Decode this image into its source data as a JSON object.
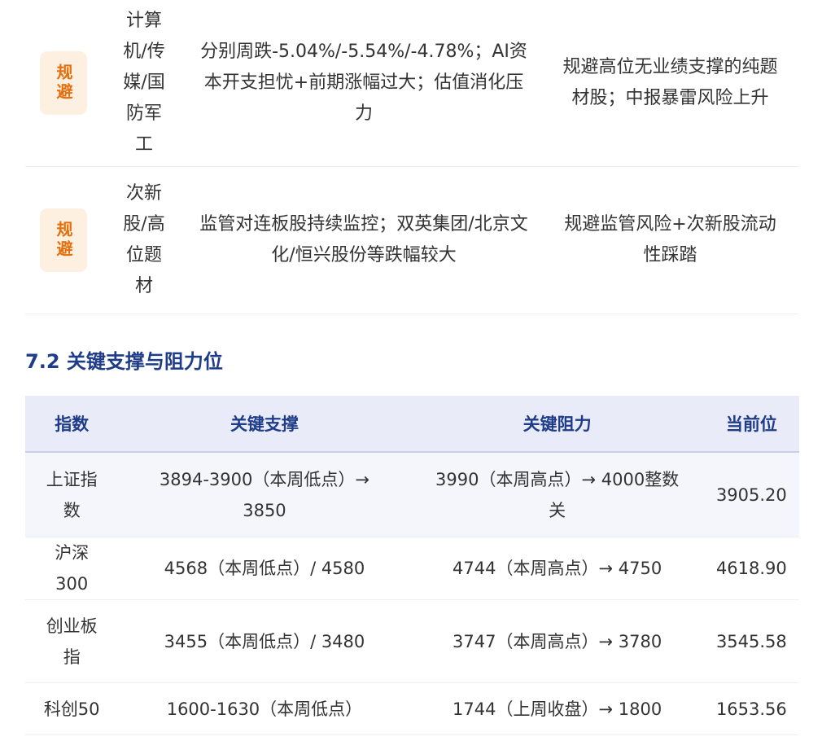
{
  "avoid_table": {
    "rows": [
      {
        "badge": "规避",
        "sector": "计算机/传媒/国防军工",
        "reason": "分别周跌-5.04%/-5.54%/-4.78%；AI资本开支担忧+前期涨幅过大；估值消化压力",
        "advice": "规避高位无业绩支撑的纯题材股；中报暴雷风险上升"
      },
      {
        "badge": "规避",
        "sector": "次新股/高位题材",
        "reason": "监管对连板股持续监控；双英集团/北京文化/恒兴股份等跌幅较大",
        "advice": "规避监管风险+次新股流动性踩踏"
      }
    ]
  },
  "section": {
    "title": "7.2 关键支撑与阻力位"
  },
  "levels_table": {
    "headers": [
      "指数",
      "关键支撑",
      "关键阻力",
      "当前位"
    ],
    "rows": [
      {
        "index": "上证指数",
        "support": "3894-3900（本周低点）→ 3850",
        "resistance": "3990（本周高点）→ 4000整数关",
        "current": "3905.20"
      },
      {
        "index": "沪深300",
        "support": "4568（本周低点）/ 4580",
        "resistance": "4744（本周高点）→ 4750",
        "current": "4618.90"
      },
      {
        "index": "创业板指",
        "support": "3455（本周低点）/ 3480",
        "resistance": "3747（本周高点）→ 3780",
        "current": "3545.58"
      },
      {
        "index": "科创50",
        "support": "1600-1630（本周低点）",
        "resistance": "1744（上周收盘）→ 1800",
        "current": "1653.56"
      }
    ]
  }
}
